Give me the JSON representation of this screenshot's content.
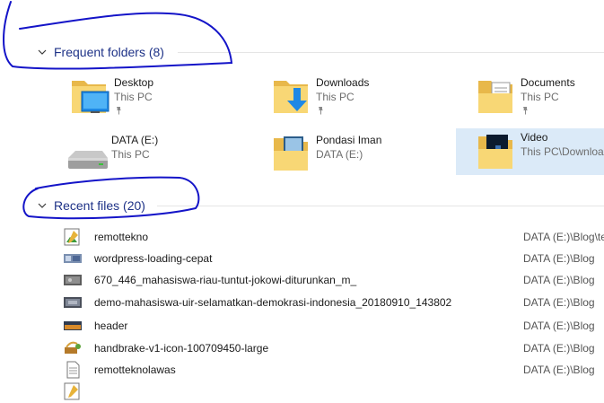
{
  "frequent": {
    "header": "Frequent folders (8)",
    "folders": [
      {
        "name": "Desktop",
        "location": "This PC",
        "pinned": true,
        "icon": "desktop-folder-icon"
      },
      {
        "name": "Downloads",
        "location": "This PC",
        "pinned": true,
        "icon": "downloads-folder-icon"
      },
      {
        "name": "Documents",
        "location": "This PC",
        "pinned": true,
        "icon": "documents-folder-icon"
      },
      {
        "name": "DATA (E:)",
        "location": "This PC",
        "pinned": false,
        "icon": "drive-icon"
      },
      {
        "name": "Pondasi Iman",
        "location": "DATA (E:)",
        "pinned": false,
        "icon": "folder-icon"
      },
      {
        "name": "Video",
        "location": "This PC\\Downloa",
        "pinned": false,
        "icon": "video-folder-icon"
      }
    ]
  },
  "recent": {
    "header": "Recent files (20)",
    "files": [
      {
        "name": "remottekno",
        "location": "DATA (E:)\\Blog\\te",
        "icon": "image-editor-icon"
      },
      {
        "name": "wordpress-loading-cepat",
        "location": "DATA (E:)\\Blog",
        "icon": "image-thumbnail-icon"
      },
      {
        "name": "670_446_mahasiswa-riau-tuntut-jokowi-diturunkan_m_",
        "location": "DATA (E:)\\Blog",
        "icon": "image-thumbnail-icon"
      },
      {
        "name": "demo-mahasiswa-uir-selamatkan-demokrasi-indonesia_20180910_143802",
        "location": "DATA (E:)\\Blog",
        "icon": "image-thumbnail-icon"
      },
      {
        "name": "header",
        "location": "DATA (E:)\\Blog",
        "icon": "image-thumbnail-icon"
      },
      {
        "name": "handbrake-v1-icon-100709450-large",
        "location": "DATA (E:)\\Blog",
        "icon": "image-thumbnail-icon"
      },
      {
        "name": "remotteknolawas",
        "location": "DATA (E:)\\Blog",
        "icon": "document-icon"
      },
      {
        "name": "",
        "location": "",
        "icon": "image-editor-icon"
      }
    ]
  },
  "colors": {
    "header_text": "#1e3287",
    "annotation": "#1414c8",
    "selected_bg": "#dbeaf8",
    "folder_yellow": "#f8d775"
  }
}
